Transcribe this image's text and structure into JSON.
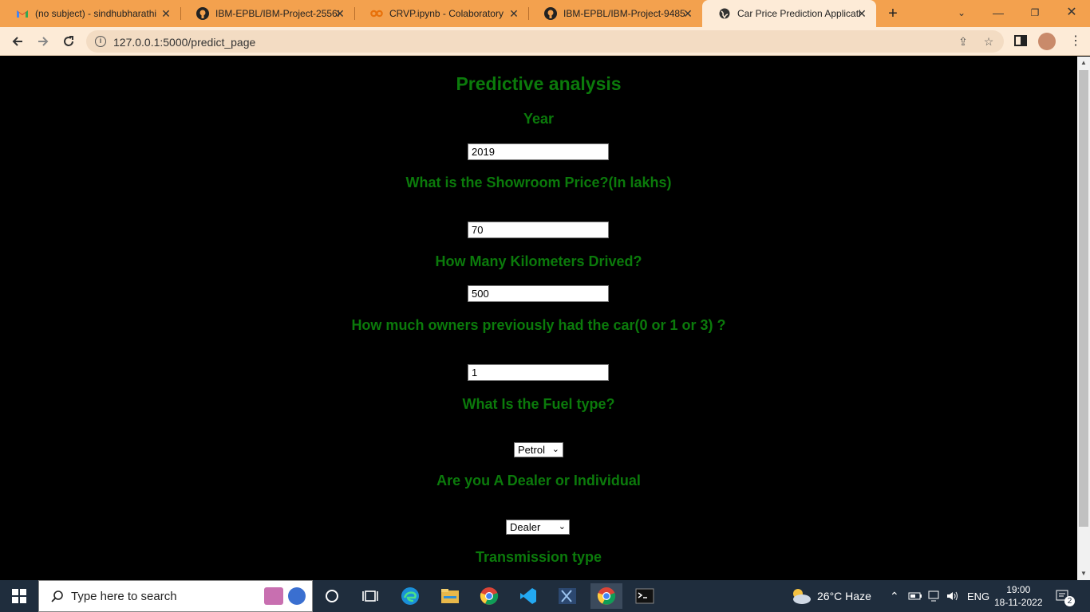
{
  "browser": {
    "tabs": [
      {
        "title": "(no subject) - sindhubharathi",
        "icon": "gmail-icon"
      },
      {
        "title": "IBM-EPBL/IBM-Project-25568",
        "icon": "github-icon"
      },
      {
        "title": "CRVP.ipynb - Colaboratory",
        "icon": "colab-icon"
      },
      {
        "title": "IBM-EPBL/IBM-Project-9485",
        "icon": "github-icon"
      },
      {
        "title": "Car Price Prediction Applicati",
        "icon": "globe-icon"
      }
    ],
    "url": "127.0.0.1:5000/predict_page"
  },
  "page": {
    "title": "Predictive analysis",
    "year_label": "Year",
    "year_value": "2019",
    "price_label": "What is the Showroom Price?(In lakhs)",
    "price_value": "70",
    "km_label": "How Many Kilometers Drived?",
    "km_value": "500",
    "owners_label": "How much owners previously had the car(0 or 1 or 3) ?",
    "owners_value": "1",
    "fuel_label": "What Is the Fuel type?",
    "fuel_value": "Petrol",
    "seller_label": "Are you A Dealer or Individual",
    "seller_value": "Dealer",
    "transmission_label": "Transmission type"
  },
  "taskbar": {
    "search_placeholder": "Type here to search",
    "weather": "26°C  Haze",
    "language": "ENG",
    "time": "19:00",
    "date": "18-11-2022",
    "notifications": "2"
  },
  "colors": {
    "heading_green": "#0b7a0b",
    "tabstrip": "#f3a14e",
    "toolbar": "#fdebd7"
  }
}
